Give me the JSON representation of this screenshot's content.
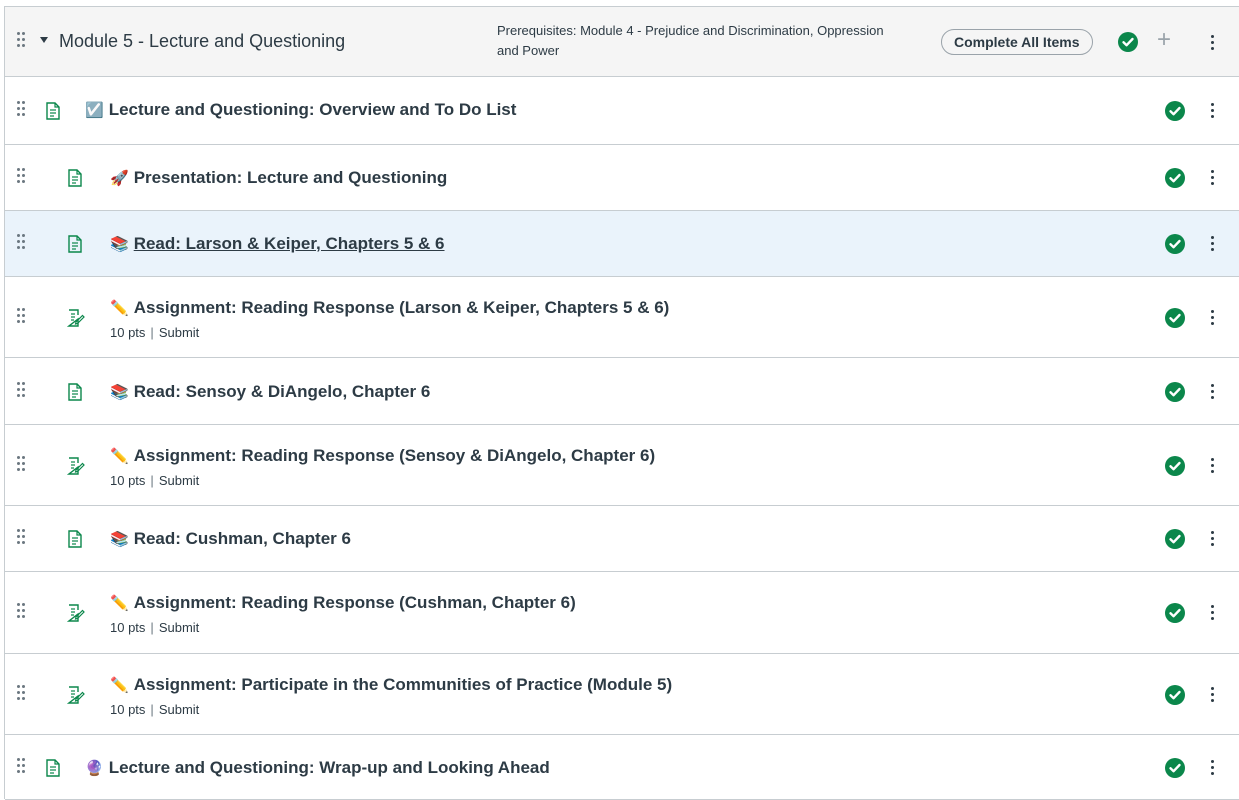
{
  "module": {
    "title": "Module 5 - Lecture and Questioning",
    "prerequisites": "Prerequisites: Module 4 - Prejudice and Discrimination, Oppression and Power",
    "complete_all_label": "Complete All Items",
    "add_label": "+",
    "accent_color": "#0b874b"
  },
  "items": [
    {
      "emoji": "☑️",
      "title": "Lecture and Questioning: Overview and To Do List",
      "type_icon": "page-icon"
    },
    {
      "emoji": "🚀",
      "title": "Presentation: Lecture and Questioning",
      "type_icon": "page-icon"
    },
    {
      "emoji": "📚",
      "title": "Read: Larson & Keiper, Chapters 5 & 6",
      "type_icon": "page-icon"
    },
    {
      "emoji": "✏️",
      "title": "Assignment: Reading Response (Larson & Keiper, Chapters 5 & 6)",
      "type_icon": "assignment-icon",
      "points": "10 pts",
      "action": "Submit"
    },
    {
      "emoji": "📚",
      "title": "Read: Sensoy & DiAngelo, Chapter 6",
      "type_icon": "page-icon"
    },
    {
      "emoji": "✏️",
      "title": "Assignment: Reading Response (Sensoy & DiAngelo, Chapter 6)",
      "type_icon": "assignment-icon",
      "points": "10 pts",
      "action": "Submit"
    },
    {
      "emoji": "📚",
      "title": "Read: Cushman, Chapter 6",
      "type_icon": "page-icon"
    },
    {
      "emoji": "✏️",
      "title": "Assignment: Reading Response (Cushman, Chapter 6)",
      "type_icon": "assignment-icon",
      "points": "10 pts",
      "action": "Submit"
    },
    {
      "emoji": "✏️",
      "title": "Assignment: Participate in the Communities of Practice (Module 5)",
      "type_icon": "assignment-icon",
      "points": "10 pts",
      "action": "Submit"
    },
    {
      "emoji": "🔮",
      "title": "Lecture and Questioning: Wrap-up and Looking Ahead",
      "type_icon": "page-icon"
    }
  ]
}
